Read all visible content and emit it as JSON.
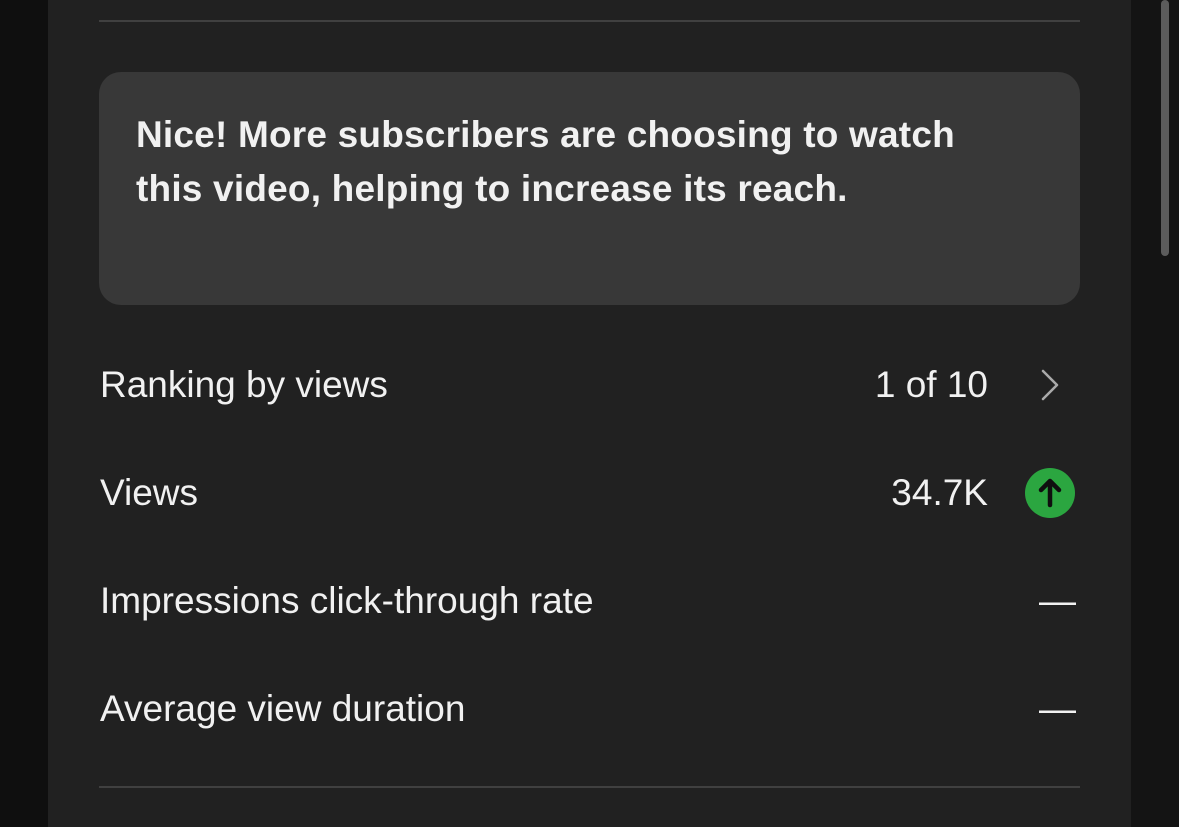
{
  "insight": {
    "message": "Nice! More subscribers are choosing to watch this video, helping to increase its reach."
  },
  "metrics": [
    {
      "label": "Ranking by views",
      "value": "1 of 10",
      "icon": "chevron-right-icon"
    },
    {
      "label": "Views",
      "value": "34.7K",
      "icon": "trend-up-icon",
      "icon_color": "#2ba640"
    },
    {
      "label": "Impressions click-through rate",
      "value": "—"
    },
    {
      "label": "Average view duration",
      "value": "—"
    }
  ]
}
